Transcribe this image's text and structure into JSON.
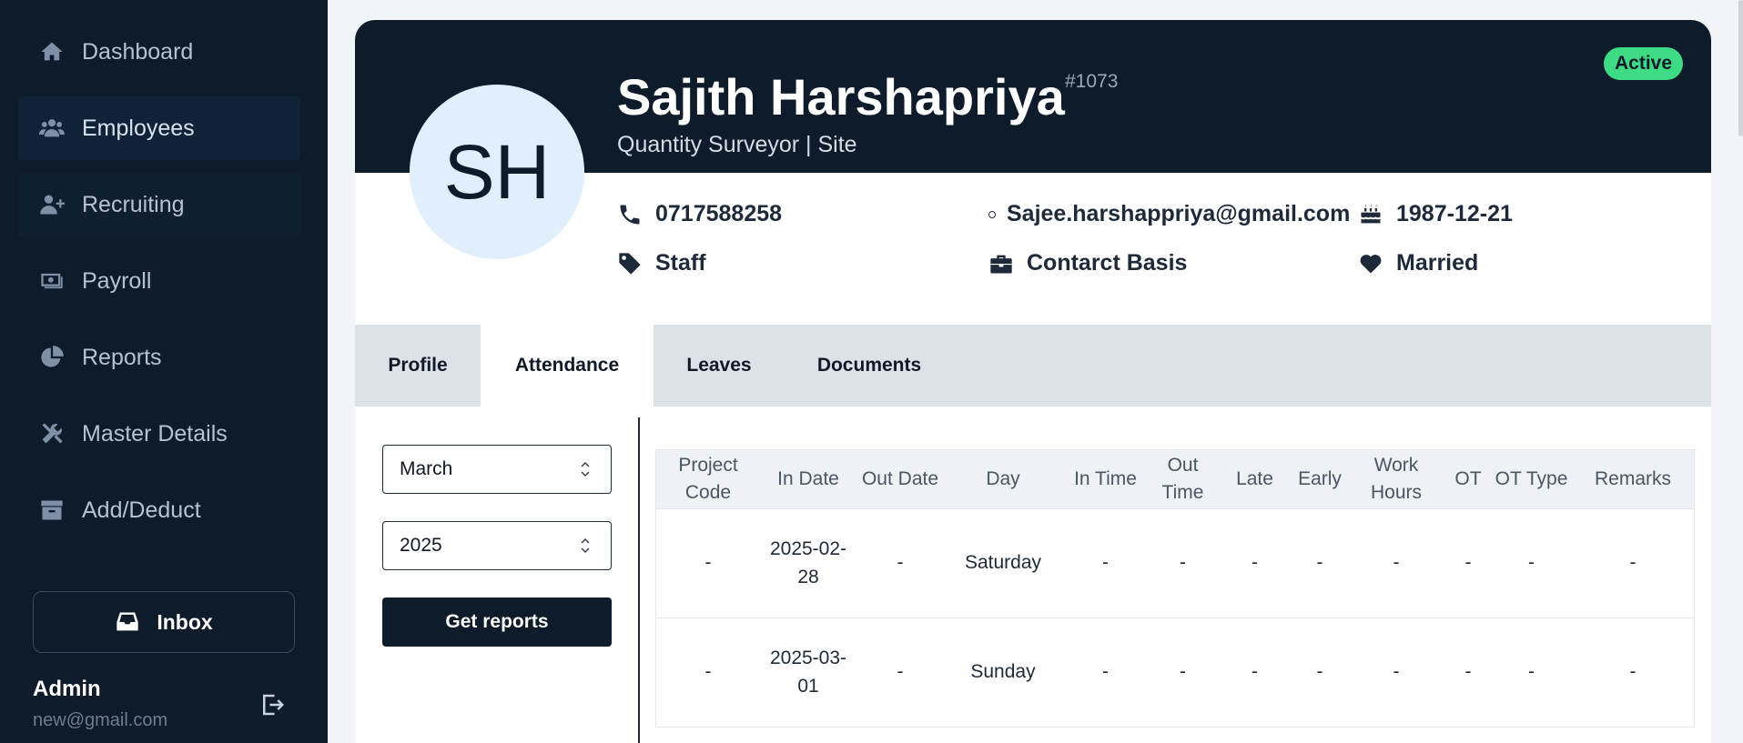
{
  "sidebar": {
    "items": [
      {
        "label": "Dashboard",
        "icon": "home-icon"
      },
      {
        "label": "Employees",
        "icon": "users-icon"
      },
      {
        "label": "Recruiting",
        "icon": "user-plus-icon"
      },
      {
        "label": "Payroll",
        "icon": "money-icon"
      },
      {
        "label": "Reports",
        "icon": "pie-chart-icon"
      },
      {
        "label": "Master Details",
        "icon": "tools-icon"
      },
      {
        "label": "Add/Deduct",
        "icon": "box-icon"
      }
    ],
    "inbox_label": "Inbox",
    "user": {
      "name": "Admin",
      "email": "new@gmail.com"
    }
  },
  "employee": {
    "initials": "SH",
    "name": "Sajith Harshapriya",
    "id": "#1073",
    "role": "Quantity Surveyor | Site",
    "status": "Active",
    "phone": "0717588258",
    "email": "Sajee.harshappriya@gmail.com",
    "dob": "1987-12-21",
    "category": "Staff",
    "employment": "Contarct Basis",
    "marital": "Married"
  },
  "tabs": [
    "Profile",
    "Attendance",
    "Leaves",
    "Documents"
  ],
  "filters": {
    "month": "March",
    "year": "2025",
    "button_label": "Get reports"
  },
  "table": {
    "headers": [
      "Project Code",
      "In Date",
      "Out Date",
      "Day",
      "In Time",
      "Out Time",
      "Late",
      "Early",
      "Work Hours",
      "OT",
      "OT Type",
      "Remarks"
    ],
    "rows": [
      [
        "-",
        "2025-02-28",
        "-",
        "Saturday",
        "-",
        "-",
        "-",
        "-",
        "-",
        "-",
        "-",
        "-"
      ],
      [
        "-",
        "2025-03-01",
        "-",
        "Sunday",
        "-",
        "-",
        "-",
        "-",
        "-",
        "-",
        "-",
        "-"
      ]
    ]
  },
  "colors": {
    "sidebar_bg": "#0d1b2a",
    "status_green": "#3ddc84",
    "avatar_bg": "#e1effc"
  }
}
